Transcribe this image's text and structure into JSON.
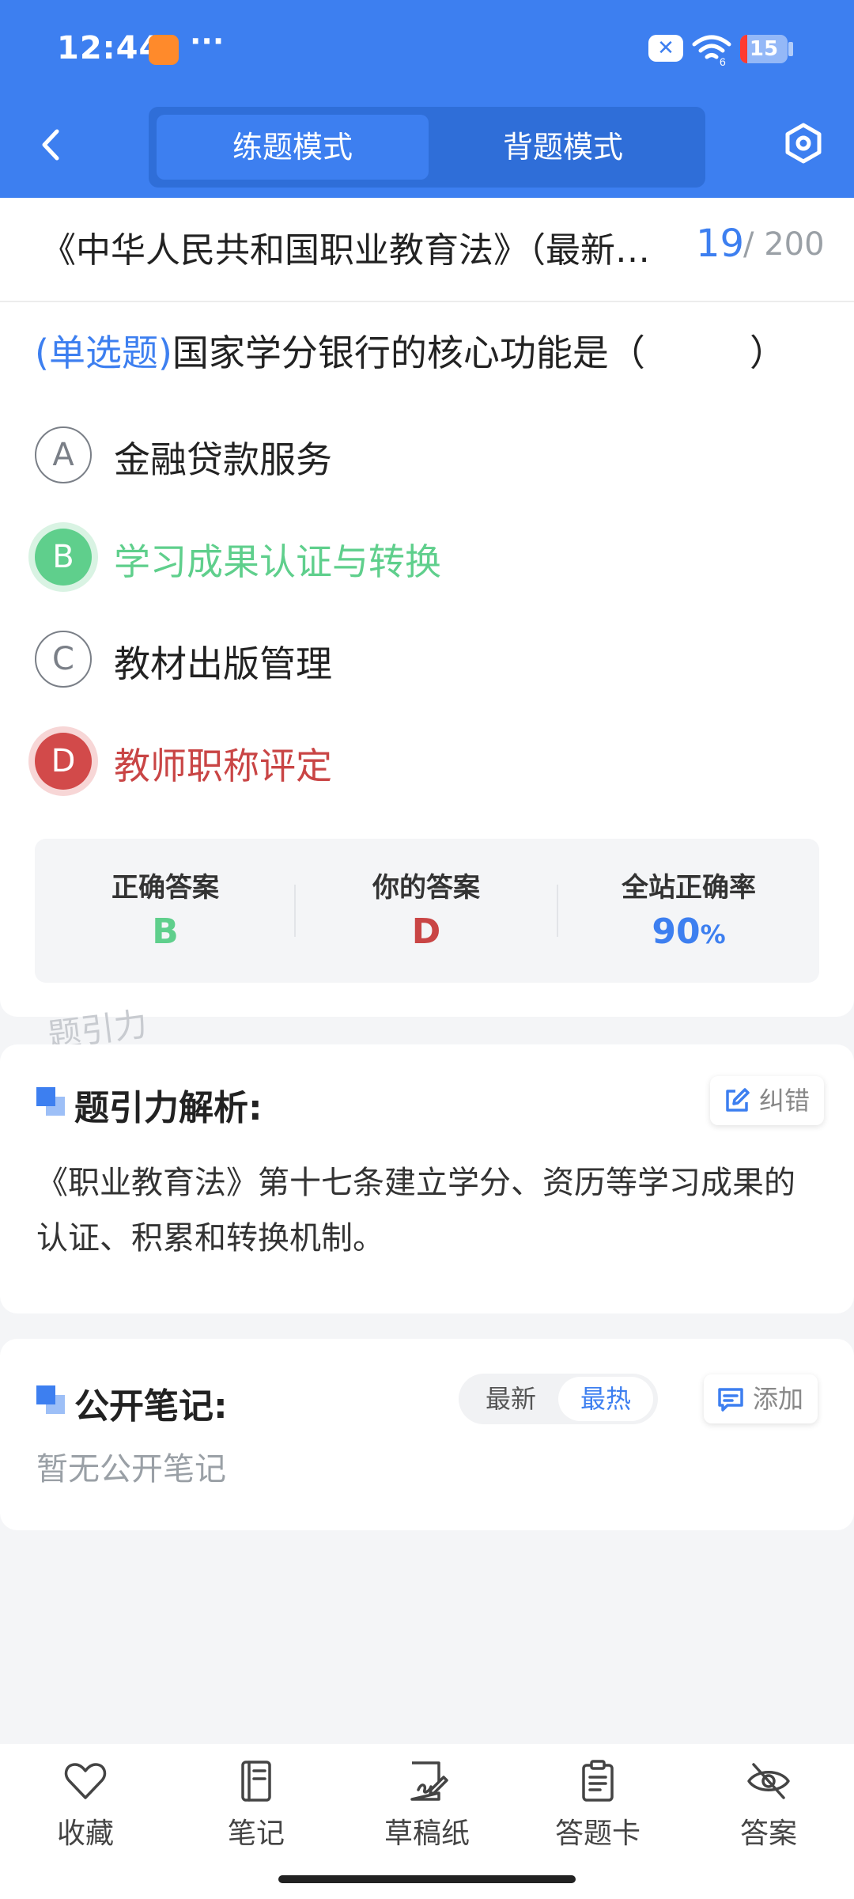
{
  "status_bar": {
    "time": "12:44",
    "more_indicator": "···",
    "notification_icon_text": "✕",
    "battery_level": 15,
    "battery_text": "15",
    "wifi_label": "6"
  },
  "nav": {
    "tabs": [
      {
        "label": "练题模式",
        "active": true
      },
      {
        "label": "背题模式",
        "active": false
      }
    ]
  },
  "question_header": {
    "title": "《中华人民共和国职业教育法》（最新版）",
    "current": "19",
    "total": "/ 200"
  },
  "question": {
    "type_label": "(单选题)",
    "stem": "国家学分银行的核心功能是（",
    "stem_close": "）",
    "options": [
      {
        "letter": "A",
        "text": "金融贷款服务",
        "state": "normal"
      },
      {
        "letter": "B",
        "text": "学习成果认证与转换",
        "state": "correct"
      },
      {
        "letter": "C",
        "text": "教材出版管理",
        "state": "normal"
      },
      {
        "letter": "D",
        "text": "教师职称评定",
        "state": "wrong"
      }
    ]
  },
  "result": {
    "correct_label": "正确答案",
    "correct_value": "B",
    "yours_label": "你的答案",
    "yours_value": "D",
    "rate_label": "全站正确率",
    "rate_value": "90",
    "rate_unit": "%"
  },
  "watermark": "题引力",
  "analysis": {
    "title": "题引力解析:",
    "report_button": "纠错",
    "text": "《职业教育法》第十七条建立学分、资历等学习成果的认证、积累和转换机制。"
  },
  "notes": {
    "title": "公开笔记:",
    "sort_options": [
      "最新",
      "最热"
    ],
    "selected_sort": "最热",
    "add_button": "添加",
    "empty_text": "暂无公开笔记"
  },
  "bottom_bar": [
    {
      "label": "收藏",
      "icon": "heart-icon"
    },
    {
      "label": "笔记",
      "icon": "notebook-icon"
    },
    {
      "label": "草稿纸",
      "icon": "draft-icon"
    },
    {
      "label": "答题卡",
      "icon": "answer-card-icon"
    },
    {
      "label": "答案",
      "icon": "eye-off-icon"
    }
  ],
  "colors": {
    "primary": "#3d7ff0",
    "correct": "#5fcf8c",
    "wrong": "#d24a4a"
  }
}
